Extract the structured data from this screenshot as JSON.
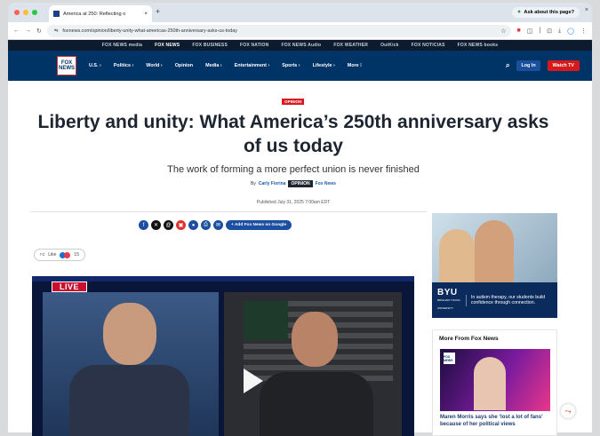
{
  "browser": {
    "tab_title": "America at 250: Reflecting o",
    "tab_close": "×",
    "new_tab": "+",
    "ask_label": "Ask about this page?",
    "window_close": "×",
    "url": "foxnews.com/opinion/liberty-unity-what-americas-250th-anniversary-asks-us-today"
  },
  "brandbar": [
    "FOX NEWS media",
    "FOX NEWS",
    "FOX BUSINESS",
    "FOX NATION",
    "FOX NEWS Audio",
    "FOX WEATHER",
    "OutKick",
    "FOX NOTICIAS",
    "FOX NEWS books"
  ],
  "nav": {
    "logo": "FOX NEWS",
    "items": [
      "U.S. ›",
      "Politics ›",
      "World ›",
      "Opinion",
      "Media ›",
      "Entertainment ›",
      "Sports ›",
      "Lifestyle ›",
      "More ⁝"
    ],
    "login": "Log In",
    "watch": "Watch TV"
  },
  "article": {
    "badge": "OPINION",
    "title": "Liberty and unity: What America’s 250th anniversary asks of us today",
    "subtitle": "The work of forming a more perfect union is never finished",
    "by": "By",
    "author": "Carly Fiorina",
    "author_tag": "OPINION",
    "outlet": "Fox News",
    "published": "Published July 31, 2025 7:00am EDT",
    "google_button": "+ Add Fox News on Google",
    "like_label": "Like",
    "reaction_count": "15"
  },
  "video": {
    "live_label": "LIVE"
  },
  "ad": {
    "brand": "BYU",
    "brand_sub": "BRIGHAM YOUNG UNIVERSITY",
    "text": "In autism therapy, our students build confidence through connection."
  },
  "sidebar": {
    "heading": "More From Fox News",
    "story": "Maren Morris says she ‘lost a lot of fans’ because of her political views"
  }
}
